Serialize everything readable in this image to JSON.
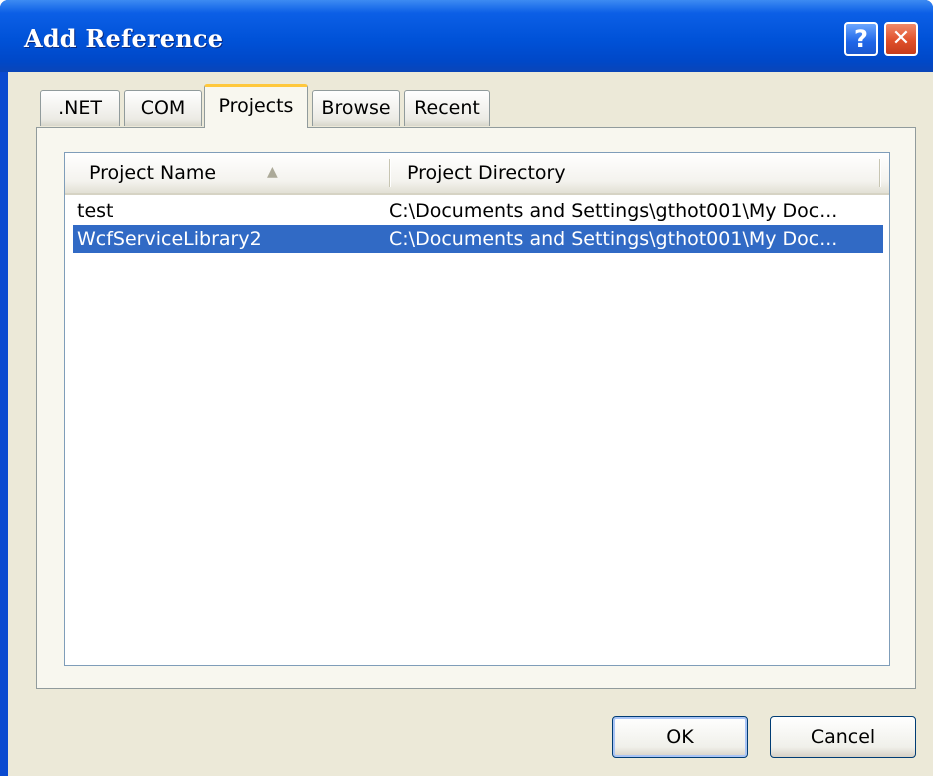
{
  "window": {
    "title": "Add Reference",
    "help_glyph": "?",
    "close_glyph": "✕"
  },
  "tabs": [
    {
      "label": ".NET",
      "active": false
    },
    {
      "label": "COM",
      "active": false
    },
    {
      "label": "Projects",
      "active": true
    },
    {
      "label": "Browse",
      "active": false
    },
    {
      "label": "Recent",
      "active": false
    }
  ],
  "list": {
    "columns": [
      "Project Name",
      "Project Directory"
    ],
    "sort_icon": "sort-ascending-icon",
    "sort_glyph": "▲",
    "rows": [
      {
        "name": "test",
        "directory": "C:\\Documents and Settings\\gthot001\\My Doc...",
        "selected": false
      },
      {
        "name": "WcfServiceLibrary2",
        "directory": "C:\\Documents and Settings\\gthot001\\My Doc...",
        "selected": true
      }
    ]
  },
  "buttons": {
    "ok": "OK",
    "cancel": "Cancel"
  },
  "colors": {
    "titlebar": "#0052d8",
    "selection": "#316ac5",
    "active_tab_accent": "#ffc83c",
    "dialog_bg": "#ece9d8"
  }
}
